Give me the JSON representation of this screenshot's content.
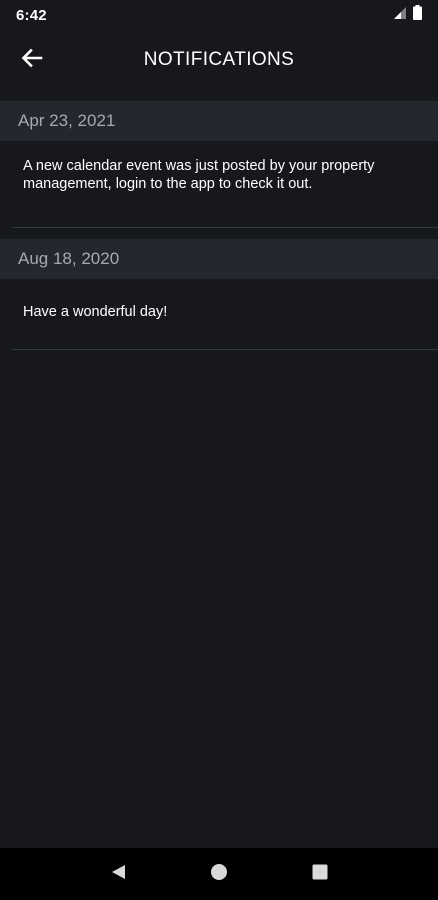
{
  "status_bar": {
    "time": "6:42",
    "icons": [
      "signal-icon",
      "battery-icon"
    ]
  },
  "app_bar": {
    "title": "NOTIFICATIONS",
    "back_icon": "back-arrow-icon"
  },
  "notifications": [
    {
      "date": "Apr 23, 2021",
      "message": "A new calendar event was just posted by your property management, login to the app to check it out."
    },
    {
      "date": "Aug 18, 2020",
      "message": "Have a wonderful day!"
    }
  ],
  "nav_bar": {
    "buttons": [
      "back-triangle-icon",
      "home-circle-icon",
      "recents-square-icon"
    ]
  },
  "colors": {
    "background": "#16181c",
    "date_header_bg": "#24272e",
    "date_text": "#a6a9ae",
    "text": "#ffffff",
    "divider": "#34373d"
  }
}
